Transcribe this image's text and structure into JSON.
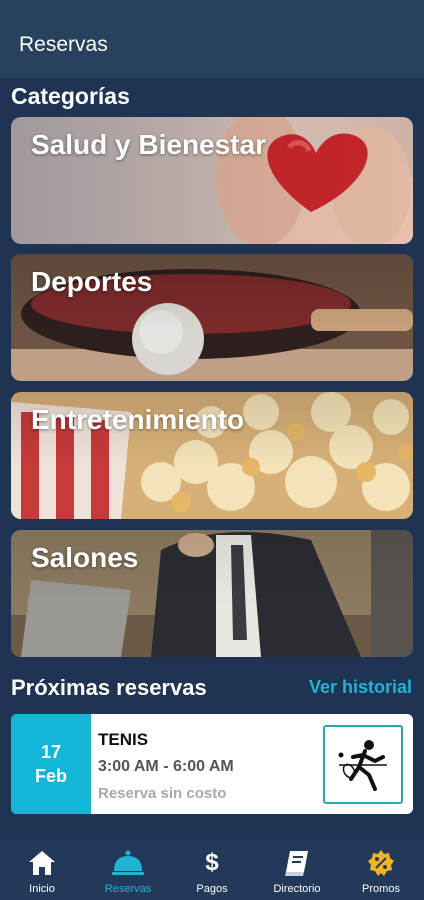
{
  "header": {
    "title": "Reservas"
  },
  "categories": {
    "title": "Categorías",
    "items": [
      {
        "label": "Salud y Bienestar"
      },
      {
        "label": "Deportes"
      },
      {
        "label": "Entretenimiento"
      },
      {
        "label": "Salones"
      }
    ]
  },
  "upcoming": {
    "title": "Próximas reservas",
    "history_link": "Ver historial",
    "reservation": {
      "day": "17",
      "month": "Feb",
      "name": "TENIS",
      "time": "3:00 AM - 6:00 AM",
      "cost": "Reserva sin costo",
      "icon": "tennis-player-icon"
    }
  },
  "nav": {
    "items": [
      {
        "label": "Inicio",
        "icon": "home-icon"
      },
      {
        "label": "Reservas",
        "icon": "bell-icon",
        "active": true
      },
      {
        "label": "Pagos",
        "icon": "dollar-icon"
      },
      {
        "label": "Directorio",
        "icon": "book-icon"
      },
      {
        "label": "Promos",
        "icon": "discount-badge-icon"
      }
    ]
  },
  "colors": {
    "background": "#1f3452",
    "header": "#27415f",
    "accent": "#14b6d8",
    "link": "#21b3d6",
    "nav_active": "#23b2d2"
  }
}
